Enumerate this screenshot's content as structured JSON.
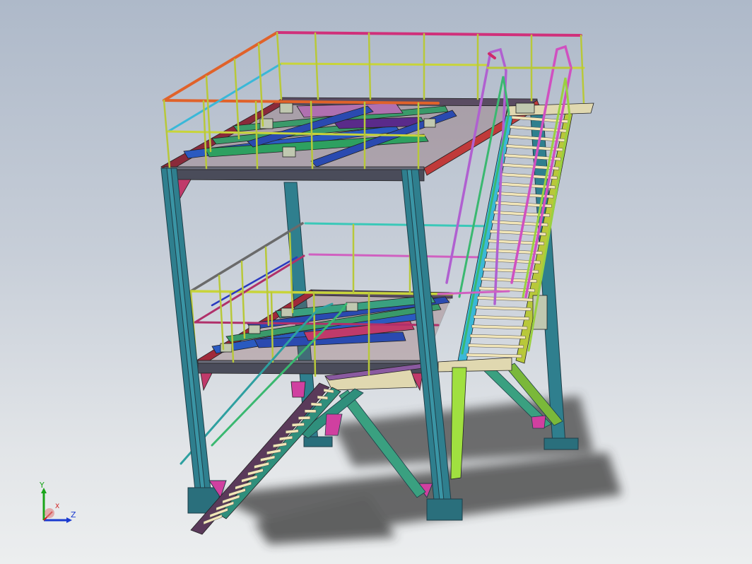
{
  "triad": {
    "y_label": "Y",
    "z_label": "Z",
    "x_label": "X",
    "y_color": "#1aa51a",
    "z_color": "#1a3ad0",
    "x_color": "#d02020"
  },
  "colors": {
    "column": "#2e7c8a",
    "beam_dark": "#4a4c5a",
    "rail_yellow": "#c8d43a",
    "rail_pink": "#d0308a",
    "rail_orange": "#e0622a",
    "rail_cyan": "#3ab8d8",
    "tread": "#f2e6b8",
    "shadow": "#3a3a3a"
  }
}
